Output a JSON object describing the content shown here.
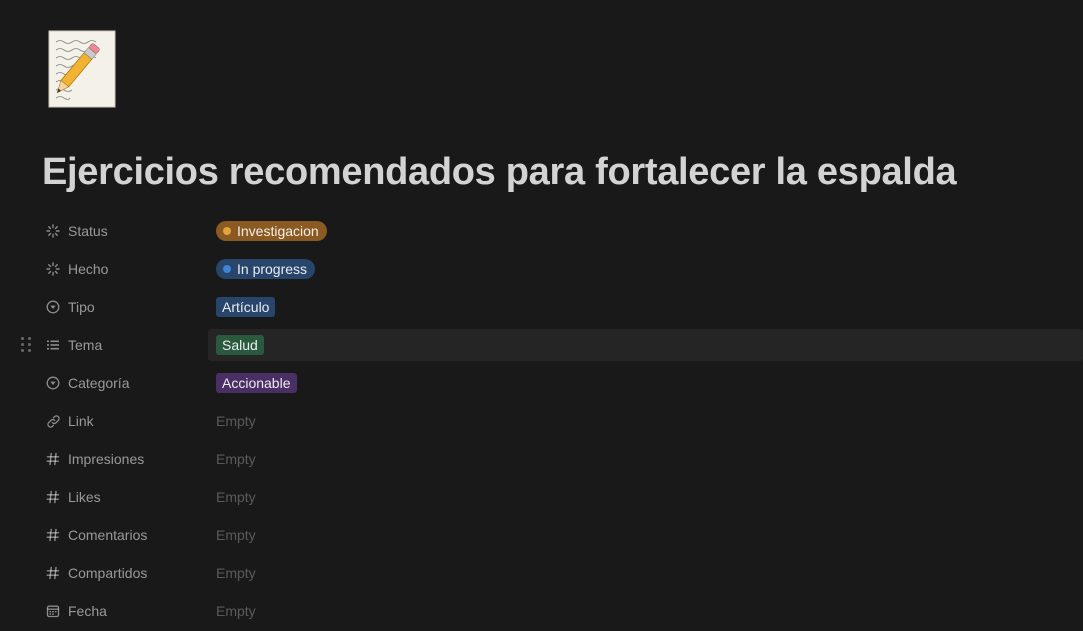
{
  "page": {
    "title": "Ejercicios recomendados para fortalecer la espalda",
    "icon": "memo-pencil-icon"
  },
  "properties": [
    {
      "name": "Status",
      "icon": "status-icon",
      "type": "status",
      "value": "Investigacion",
      "bg": "#8a5a22",
      "dot": "#e3a33d"
    },
    {
      "name": "Hecho",
      "icon": "status-icon",
      "type": "status",
      "value": "In progress",
      "bg": "#28456c",
      "dot": "#3f83d6"
    },
    {
      "name": "Tipo",
      "icon": "select-icon",
      "type": "select",
      "value": "Artículo",
      "bg": "#28456c"
    },
    {
      "name": "Tema",
      "icon": "multi-select-icon",
      "type": "select",
      "value": "Salud",
      "bg": "#2b593f"
    },
    {
      "name": "Categoría",
      "icon": "select-icon",
      "type": "select",
      "value": "Accionable",
      "bg": "#492f64"
    },
    {
      "name": "Link",
      "icon": "link-icon",
      "type": "empty",
      "value": "Empty"
    },
    {
      "name": "Impresiones",
      "icon": "number-icon",
      "type": "empty",
      "value": "Empty"
    },
    {
      "name": "Likes",
      "icon": "number-icon",
      "type": "empty",
      "value": "Empty"
    },
    {
      "name": "Comentarios",
      "icon": "number-icon",
      "type": "empty",
      "value": "Empty"
    },
    {
      "name": "Compartidos",
      "icon": "number-icon",
      "type": "empty",
      "value": "Empty"
    },
    {
      "name": "Fecha",
      "icon": "calendar-icon",
      "type": "empty",
      "value": "Empty"
    }
  ],
  "colors": {
    "background": "#191919",
    "hover_row": "#252525"
  }
}
